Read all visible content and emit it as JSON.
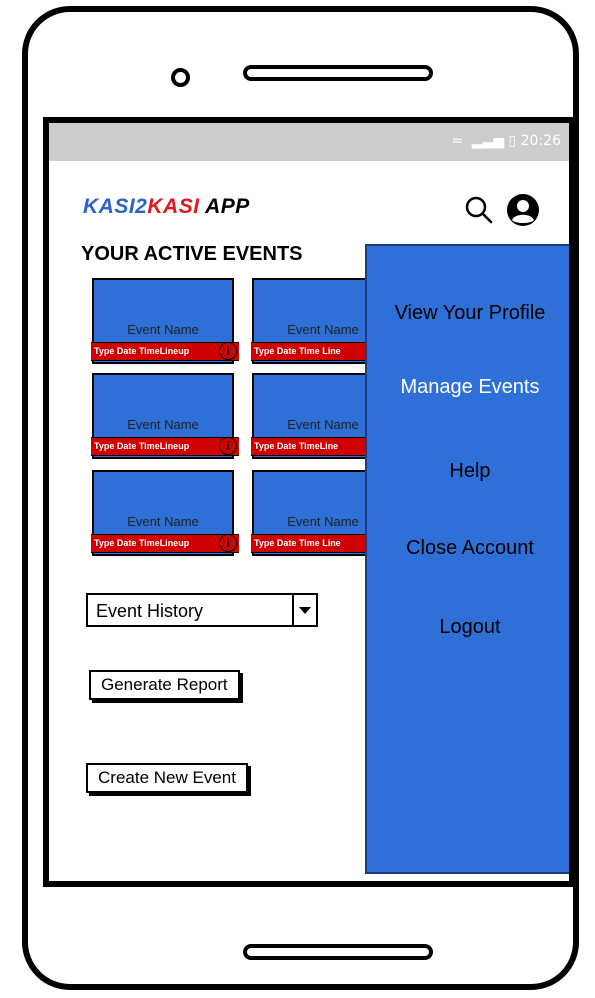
{
  "status_bar": {
    "time": "20:26",
    "wifi_icon": "wifi-icon",
    "signal_icon": "signal-icon",
    "battery_icon": "battery-icon"
  },
  "app": {
    "logo_part1": "KASI2",
    "logo_part2": "KASI",
    "logo_part3": " APP",
    "search_icon": "search-icon",
    "user_icon": "user-icon"
  },
  "section_title": "YOUR ACTIVE EVENTS",
  "events": [
    {
      "name": "Event Name",
      "info": "Type Date TimeLineup"
    },
    {
      "name": "Event Name",
      "info": "Type Date Time Line"
    },
    {
      "name": "Event Name",
      "info": "Type Date TimeLineup"
    },
    {
      "name": "Event Name",
      "info": "Type Date  TimeLine"
    },
    {
      "name": "Event Name",
      "info": "Type Date TimeLineup"
    },
    {
      "name": "Event Name",
      "info": "Type Date Time Line"
    }
  ],
  "event_history_select": "Event History",
  "generate_report_label": "Generate Report",
  "create_event_label": "Create New Event",
  "menu": {
    "items": [
      "View Your Profile",
      "Manage Events",
      "Help",
      "Close Account",
      "Logout"
    ]
  },
  "colors": {
    "accent": "#2f6fd8",
    "badge": "#d00000",
    "logo_blue": "#2a63c9",
    "logo_red": "#e0171f"
  }
}
